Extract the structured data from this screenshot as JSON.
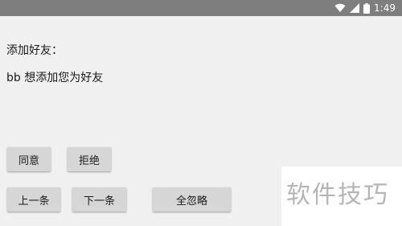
{
  "status_bar": {
    "time": "1:49",
    "icons": [
      "wifi-icon",
      "signal-icon",
      "battery-icon"
    ]
  },
  "dialog": {
    "title": "添加好友：",
    "message": "bb  想添加您为好友"
  },
  "buttons": {
    "agree": "同意",
    "reject": "拒绝",
    "previous": "上一条",
    "next": "下一条",
    "ignore_all": "全忽略"
  },
  "watermark": {
    "text": "软件技巧"
  },
  "colors": {
    "status_bar": "#7e7e7e",
    "background": "#f0f0f0",
    "button": "#d6d6d6"
  }
}
